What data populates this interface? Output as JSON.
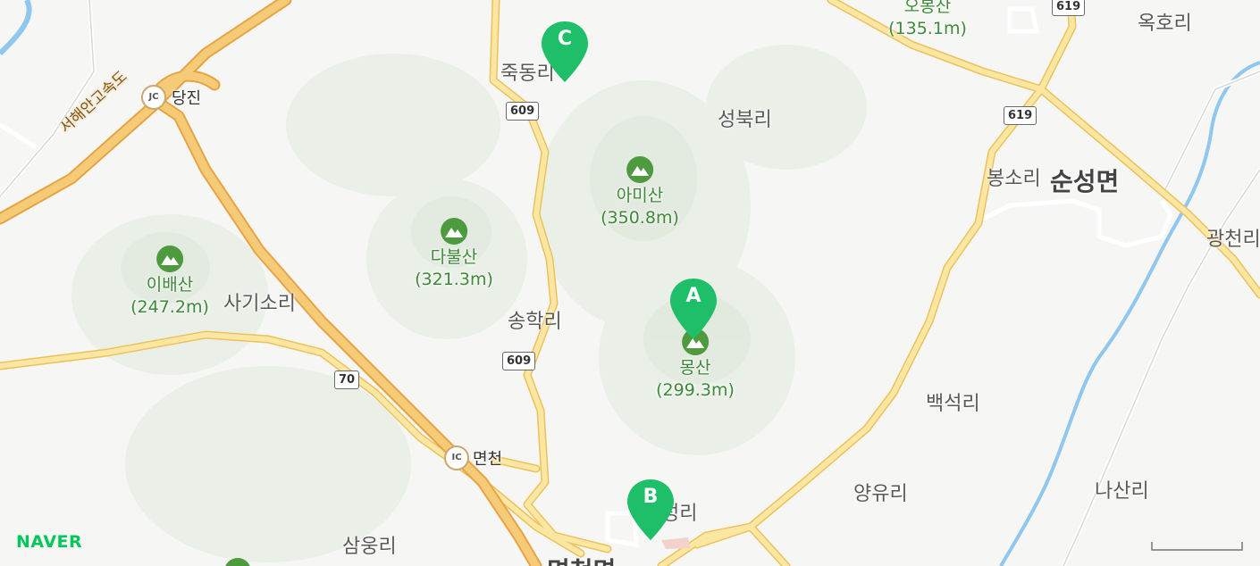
{
  "map": {
    "brand": "NAVER",
    "expressway_label": "서해안고속도",
    "markers": [
      {
        "letter": "A",
        "color": "#1fbf6a"
      },
      {
        "letter": "B",
        "color": "#1fbf6a"
      },
      {
        "letter": "C",
        "color": "#1fbf6a"
      }
    ],
    "mountains": [
      {
        "name": "오봉산",
        "height": "(135.1m)"
      },
      {
        "name": "아미산",
        "height": "(350.8m)"
      },
      {
        "name": "다불산",
        "height": "(321.3m)"
      },
      {
        "name": "이배산",
        "height": "(247.2m)"
      },
      {
        "name": "몽산",
        "height": "(299.3m)"
      }
    ],
    "villages": [
      "죽동리",
      "성북리",
      "옥호리",
      "봉소리",
      "광천리",
      "사기소리",
      "송학리",
      "백석리",
      "양유리",
      "나산리",
      "삼웅리",
      "성리"
    ],
    "towns": [
      "순성면",
      "면천면"
    ],
    "interchanges": [
      {
        "badge": "JC",
        "name": "당진"
      },
      {
        "badge": "IC",
        "name": "면천"
      }
    ],
    "routes": [
      "609",
      "609",
      "619",
      "619",
      "70"
    ],
    "colors": {
      "road": "#f7d57c",
      "expressway": "#f0b85a",
      "water": "#8fc7ee",
      "mountain_text": "#3d8a3a",
      "marker": "#1fbf6a"
    }
  }
}
